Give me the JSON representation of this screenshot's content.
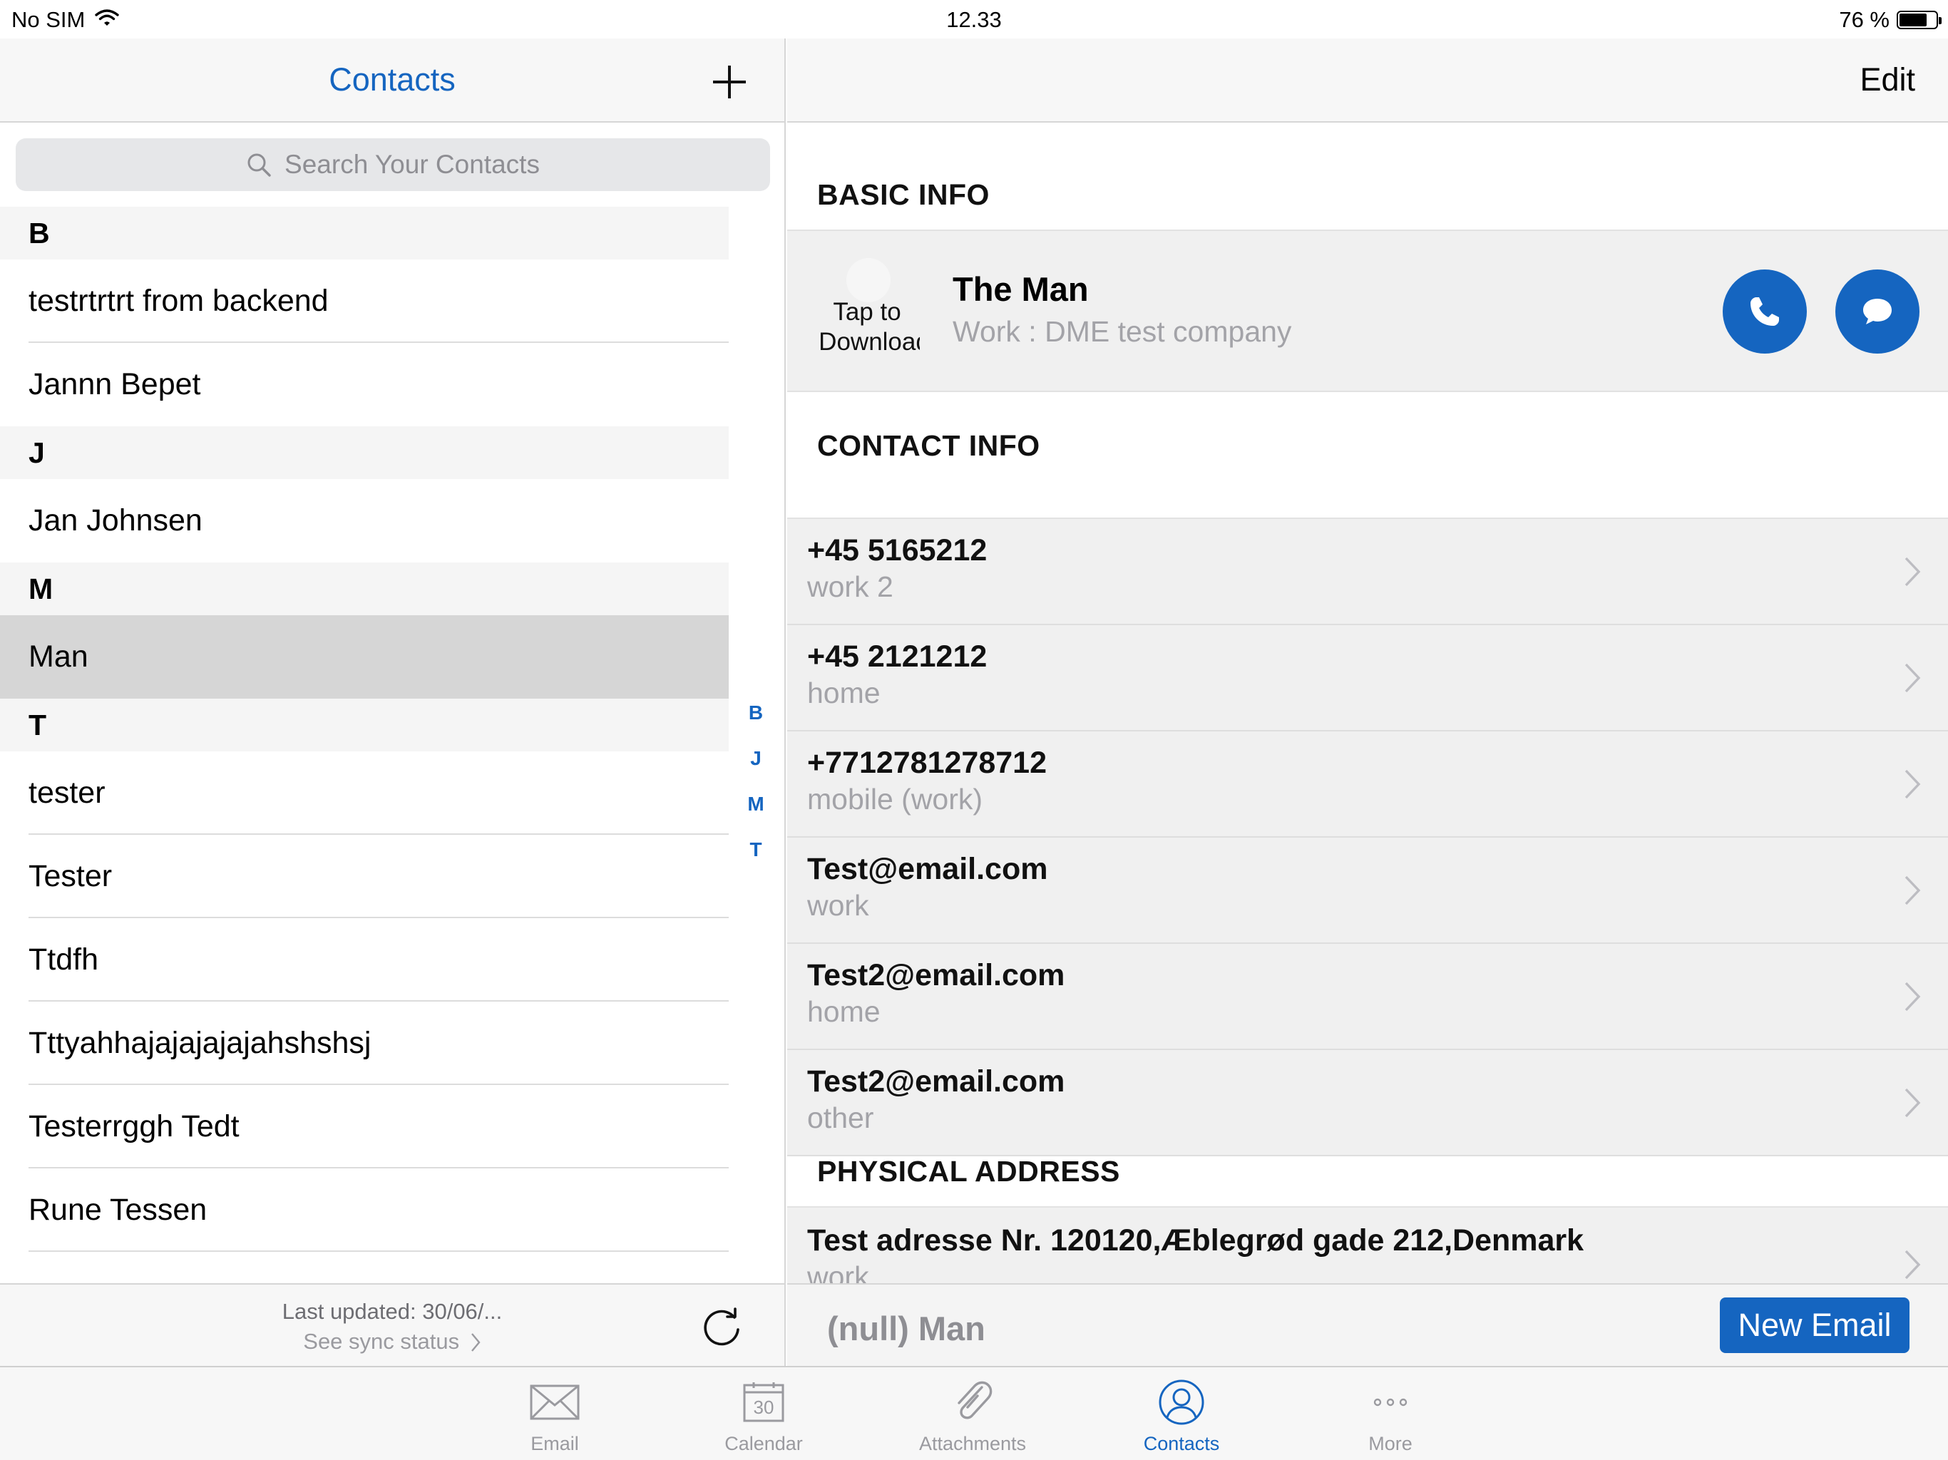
{
  "status_bar": {
    "carrier": "No SIM",
    "time": "12.33",
    "battery_text": "76 %",
    "battery_level": 0.76
  },
  "contacts_pane": {
    "title": "Contacts",
    "search_placeholder": "Search Your Contacts",
    "sections": [
      {
        "letter": "B",
        "contacts": [
          "testrtrtrt from backend",
          "Jannn Bepet"
        ]
      },
      {
        "letter": "J",
        "contacts": [
          "Jan  Johnsen"
        ]
      },
      {
        "letter": "M",
        "contacts": [
          "Man"
        ]
      },
      {
        "letter": "T",
        "contacts": [
          "tester",
          "Tester",
          "Ttdfh",
          "Tttyahhajajajajajahshshsj",
          "Testerrggh Tedt",
          "Rune Tessen"
        ]
      }
    ],
    "selected_contact": "Man",
    "index_letters": [
      "B",
      "J",
      "M",
      "T"
    ],
    "sync": {
      "last_updated": "Last updated: 30/06/...",
      "status_link": "See sync status"
    }
  },
  "detail_pane": {
    "edit_label": "Edit",
    "basic_info_label": "BASIC INFO",
    "avatar_text_line1": "Tap to",
    "avatar_text_line2": "Download",
    "contact_name": "The Man",
    "contact_work": "Work : DME test company",
    "contact_info_label": "CONTACT INFO",
    "contact_info": [
      {
        "value": "+45 5165212",
        "label": "work 2"
      },
      {
        "value": "+45 2121212",
        "label": "home"
      },
      {
        "value": "+7712781278712",
        "label": "mobile (work)"
      },
      {
        "value": "Test@email.com",
        "label": "work"
      },
      {
        "value": "Test2@email.com",
        "label": "home"
      },
      {
        "value": "Test2@email.com",
        "label": "other"
      }
    ],
    "physical_address_label": "PHYSICAL ADDRESS",
    "address": {
      "value": "Test adresse Nr. 120120,Æblegrød gade 212,Denmark",
      "label": "work"
    },
    "action_bar_name": "(null) Man",
    "new_email_label": "New Email"
  },
  "tab_bar": {
    "tabs": [
      {
        "label": "Email",
        "icon": "envelope-icon"
      },
      {
        "label": "Calendar",
        "icon": "calendar-icon",
        "icon_text": "30"
      },
      {
        "label": "Attachments",
        "icon": "paperclip-icon"
      },
      {
        "label": "Contacts",
        "icon": "contacts-icon"
      },
      {
        "label": "More",
        "icon": "more-icon"
      }
    ],
    "active_tab": "Contacts"
  },
  "colors": {
    "accent": "#1565c0",
    "selected_row": "#d6d6d6",
    "card_background": "#f0f0f0",
    "secondary_text": "#a3a3a8"
  }
}
